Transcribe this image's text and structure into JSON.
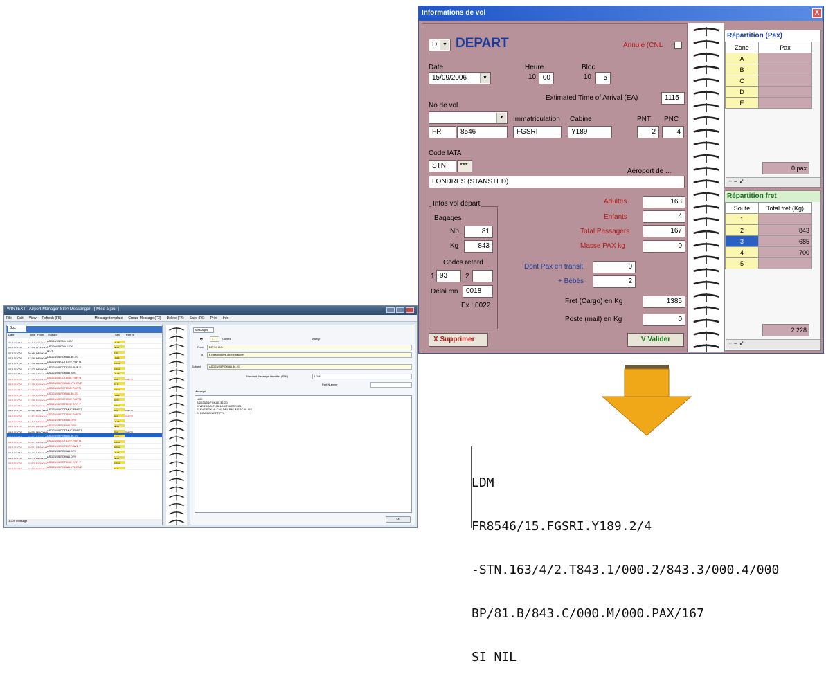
{
  "mail_window": {
    "title": "WINTEXT - Airport Manager SITA Messenger - [ Mise à jour ]",
    "menu": [
      "File",
      "Edit",
      "View",
      "Refresh (F5)",
      "Message template",
      "Create Message (F3)",
      "Delete (F4)",
      "Save (F6)",
      "Print",
      "Info"
    ],
    "folder_label": "Box",
    "columns": [
      "Date",
      "Time",
      "From",
      "Subject",
      "SMI",
      "Part nr"
    ],
    "rows": [
      {
        "date": "06/10/2007",
        "time": "06:34",
        "from": "LCYXHAA",
        "subject": "ASD20/05/0000 LCY",
        "smi": "MVT",
        "part": "",
        "style": ""
      },
      {
        "date": "06/10/2007",
        "time": "07:30",
        "from": "LCYXHAA",
        "subject": "ASD20/05/0000 LCY",
        "smi": "MVT",
        "part": "",
        "style": ""
      },
      {
        "date": "07/10/2007",
        "time": "20:46",
        "from": "DRYXHA",
        "subject": "MVT",
        "smi": "SSI",
        "part": "",
        "style": ""
      },
      {
        "date": "07/10/2007",
        "time": "07:36",
        "from": "DRYXHA",
        "subject": "ASD25/05.FGKAB.36.2/1",
        "smi": "LDM",
        "part": "",
        "style": ""
      },
      {
        "date": "07/10/2007",
        "time": "07:35",
        "from": "DRYXHA",
        "subject": "ASD25/05/0CT DRY PART1",
        "smi": "PSM",
        "part": "",
        "style": ""
      },
      {
        "date": "07/10/2007",
        "time": "07:37",
        "from": "DRYXHA",
        "subject": "ASD25/05/0CT DRY/BVE P",
        "smi": "PSM",
        "part": "",
        "style": ""
      },
      {
        "date": "07/10/2007",
        "time": "07:37",
        "from": "DRYXHA",
        "subject": "ASD25/05.FGKAB.BVE",
        "smi": "MVT",
        "part": "",
        "style": ""
      },
      {
        "date": "08/10/2007",
        "time": "07:35",
        "from": "BVEXHA",
        "subject": "ASD25/05/0CT BVE PART1",
        "smi": "PNL",
        "part": "PART1",
        "style": "red"
      },
      {
        "date": "08/10/2007",
        "time": "07:35",
        "from": "BVEXHA",
        "subject": "ASD25/05.FGKAB.Y78.BVE",
        "smi": "SLS",
        "part": "",
        "style": "red"
      },
      {
        "date": "08/10/2007",
        "time": "07:35",
        "from": "BVEXHA",
        "subject": "ASD25/05/0CT BVE PART1",
        "smi": "PSM",
        "part": "",
        "style": "red"
      },
      {
        "date": "08/10/2007",
        "time": "07:35",
        "from": "BVEXHA",
        "subject": "ASD25/05.FGKAB.36.2/1",
        "smi": "LDM",
        "part": "",
        "style": "red"
      },
      {
        "date": "08/10/2007",
        "time": "07:35",
        "from": "BVEXHA",
        "subject": "ASD25/05/0CT BVE PART1",
        "smi": "PFS",
        "part": "",
        "style": "red"
      },
      {
        "date": "08/10/2007",
        "time": "07:35",
        "from": "BVEXHA",
        "subject": "ASD25/05/0CT BVE DRY P",
        "smi": "PSM",
        "part": "",
        "style": "red"
      },
      {
        "date": "08/10/2007",
        "time": "06:56",
        "from": "MUCXHA",
        "subject": "ASD25/05/0CT MVC PART1",
        "smi": "PNL",
        "part": "PART1",
        "style": ""
      },
      {
        "date": "08/10/2007",
        "time": "02:51",
        "from": "BVEXHA",
        "subject": "ASD25/05/0CT BVE PART1",
        "smi": "PNL",
        "part": "PART1",
        "style": "red"
      },
      {
        "date": "08/10/2007",
        "time": "20:14",
        "from": "DRYXHA",
        "subject": "ASD25/05.FGKAB.DRY",
        "smi": "MVT",
        "part": "",
        "style": "red"
      },
      {
        "date": "08/10/2007",
        "time": "20:14",
        "from": "DRYXHA",
        "subject": "ASD25/05.FGKAB.DRY",
        "smi": "MVT",
        "part": "",
        "style": "red"
      },
      {
        "date": "08/10/2007",
        "time": "20:55",
        "from": "MUCXHA",
        "subject": "ASD25/05/0CT MVC PART1",
        "smi": "PNL",
        "part": "PART1",
        "style": ""
      },
      {
        "date": "08/10/2007",
        "time": "20:51",
        "from": "DRYXHA",
        "subject": "ASD25/05.FGKAB.36.2/1",
        "smi": "LDM",
        "part": "",
        "style": "sel"
      },
      {
        "date": "08/10/2007",
        "time": "20:51",
        "from": "DRYXHA",
        "subject": "ASD25/05/0CT DRY PART1",
        "smi": "PSM",
        "part": "",
        "style": "red"
      },
      {
        "date": "08/10/2007",
        "time": "20:51",
        "from": "DRYXHA",
        "subject": "ASD25/05/0CT DRY/BVE P",
        "smi": "PSM",
        "part": "",
        "style": "red"
      },
      {
        "date": "08/10/2007",
        "time": "19:40",
        "from": "DRYXHA",
        "subject": "ASD25/05.FGKAB.DRY",
        "smi": "MVT",
        "part": "",
        "style": ""
      },
      {
        "date": "08/10/2007",
        "time": "19:22",
        "from": "DRYXHA",
        "subject": "ASD25/05.FGKAB.DRY",
        "smi": "MVT",
        "part": "",
        "style": ""
      },
      {
        "date": "08/10/2007",
        "time": "18:53",
        "from": "BVEXHA",
        "subject": "ASD25/05/0CT BVE DRY P",
        "smi": "PSM",
        "part": "",
        "style": "red"
      },
      {
        "date": "08/10/2007",
        "time": "18:53",
        "from": "BVEXHA",
        "subject": "ASD25/05.FGKAB.Y78.BVE",
        "smi": "SLS",
        "part": "",
        "style": "red"
      }
    ],
    "footer": "1 209 message",
    "tab": "Messages",
    "copies_label": "Copies",
    "copies_value": "1",
    "airinc_label": "Aairxp",
    "from_label": "From",
    "from_value": "DRYXHAN",
    "to_label": "To",
    "to_value": "b.mesnil@live.airlinemail.net",
    "subject_label": "Subject",
    "subject_value": "ASD25/05/FGKAB.36.2/1",
    "smi_label": "Standard Message Identifier (SMI)",
    "smi_value": "LDM",
    "part_label": "Part Number",
    "message_label": "Message",
    "message_body": "LDM\nASD25/05/FGKAB.36.2/1\n-DVE.26/0/0.T105.1/95/T96.BR/4/20\nSI BVE/FGKAB.CNL.DNL.BNL.MERCIALAIS\nSI CGA/ADN DFT FYL",
    "ok_label": "Ok"
  },
  "dialog": {
    "title": "Informations de vol",
    "close_glyph": "X",
    "direction_value": "D",
    "direction_title": "DEPART",
    "cancelled_label": "Annulé (CNL",
    "date_label": "Date",
    "date_value": "15/09/2006",
    "heure_label": "Heure",
    "heure_h": "10",
    "heure_m": "00",
    "bloc_label": "Bloc",
    "bloc_h": "10",
    "bloc_m": "5",
    "eta_label": "Extimated Time of Arrival (EA)",
    "eta_value": "1115",
    "novol_label": "No de vol",
    "airline_code": "FR",
    "flight_number": "8546",
    "immat_label": "Immatriculation",
    "immat_value": "FGSRI",
    "cabine_label": "Cabine",
    "cabine_value": "Y189",
    "pnt_label": "PNT",
    "pnt_value": "2",
    "pnc_label": "PNC",
    "pnc_value": "4",
    "iata_label": "Code IATA",
    "iata_value": "STN",
    "iata_button": "***",
    "airport_label": "Aéroport de ...",
    "airport_value": "LONDRES (STANSTED)",
    "depart_group": "Infos vol départ",
    "bagages_label": "Bagages",
    "nb_label": "Nb",
    "nb_value": "81",
    "kg_label": "Kg",
    "kg_value": "843",
    "retard_label": "Codes retard",
    "retard1_label": "1",
    "retard1_value": "93",
    "retard2_label": "2",
    "retard2_value": "",
    "delai_label": "Délai mn",
    "delai_value": "0018",
    "ex_label": "Ex : 0022",
    "adultes_label": "Adultes",
    "adultes_value": "163",
    "enfants_label": "Enfants",
    "enfants_value": "4",
    "total_pax_label": "Total Passagers",
    "total_pax_value": "167",
    "masse_label": "Masse PAX  kg",
    "masse_value": "0",
    "dont_label": "Dont Pax en transit",
    "dont_value": "0",
    "bebes_label": "+ Bébés",
    "bebes_value": "2",
    "fret_label": "Fret (Cargo) en Kg",
    "fret_value": "1385",
    "poste_label": "Poste (mail) en Kg",
    "poste_value": "0",
    "supprimer_label": "X Supprimer",
    "valider_label": "V Valider",
    "rep_pax_title": "Répartition (Pax)",
    "rep_pax_headers": [
      "Zone",
      "Pax"
    ],
    "rep_pax_rows": [
      "A",
      "B",
      "C",
      "D",
      "E"
    ],
    "rep_pax_total": "0 pax",
    "rep_fret_title": "Répartition fret",
    "rep_fret_headers": [
      "Soute",
      "Total fret (Kg)"
    ],
    "rep_fret_rows": [
      {
        "soute": "1",
        "kg": ""
      },
      {
        "soute": "2",
        "kg": "843"
      },
      {
        "soute": "3",
        "kg": "685"
      },
      {
        "soute": "4",
        "kg": "700"
      },
      {
        "soute": "5",
        "kg": ""
      }
    ],
    "rep_fret_total": "2 228",
    "nav_glyphs": "+ − ✓"
  },
  "output": {
    "lines": [
      "LDM",
      "FR8546/15.FGSRI.Y189.2/4",
      "-STN.163/4/2.T843.1/000.2/843.3/000.4/000",
      "BP/81.B/843.C/000.M/000.PAX/167",
      "SI NIL"
    ]
  },
  "colors": {
    "dialog_bg": "#b7909a",
    "title_bar": "#1f56c8",
    "arrow": "#f0a818",
    "highlight": "#2b5fc2"
  }
}
